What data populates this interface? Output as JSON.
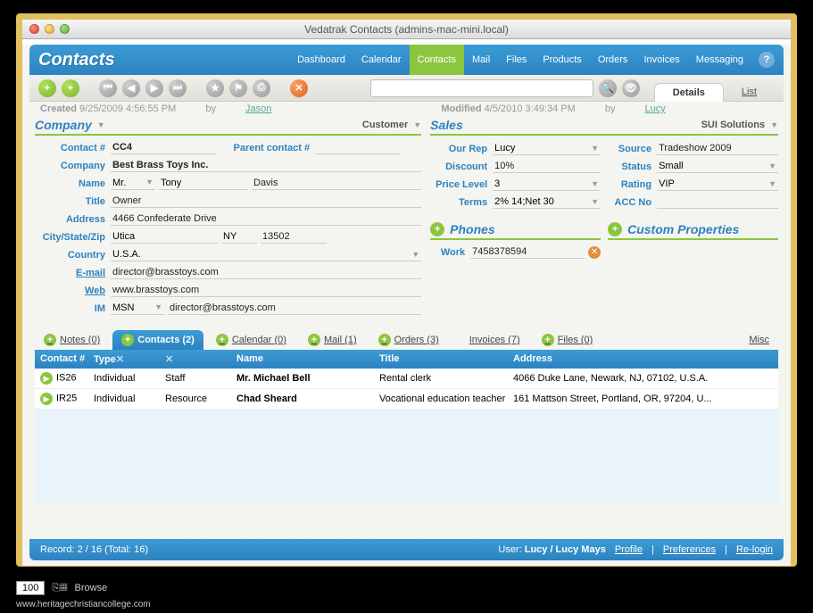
{
  "window_title": "Vedatrak Contacts (admins-mac-mini.local)",
  "brand": "Contacts",
  "nav": [
    "Dashboard",
    "Calendar",
    "Contacts",
    "Mail",
    "Files",
    "Products",
    "Orders",
    "Invoices",
    "Messaging"
  ],
  "nav_active": "Contacts",
  "right_tabs": {
    "details": "Details",
    "list": "List"
  },
  "meta": {
    "created_label": "Created",
    "created": "9/25/2009 4:56:55 PM",
    "created_by_label": "by",
    "created_by": "Jason",
    "modified_label": "Modified",
    "modified": "4/5/2010 3:49:34 PM",
    "modified_by_label": "by",
    "modified_by": "Lucy"
  },
  "company": {
    "section": "Company",
    "type_label": "Customer",
    "contact_no_label": "Contact #",
    "contact_no": "CC4",
    "parent_label": "Parent contact #",
    "parent": "",
    "company_label": "Company",
    "company": "Best Brass Toys Inc.",
    "name_label": "Name",
    "prefix": "Mr.",
    "first": "Tony",
    "last": "Davis",
    "title_label": "Title",
    "title": "Owner",
    "address_label": "Address",
    "address": "4466 Confederate Drive",
    "csz_label": "City/State/Zip",
    "city": "Utica",
    "state": "NY",
    "zip": "13502",
    "country_label": "Country",
    "country": "U.S.A.",
    "email_label": "E-mail",
    "email": "director@brasstoys.com",
    "web_label": "Web",
    "web": "www.brasstoys.com",
    "im_label": "IM",
    "im_type": "MSN",
    "im": "director@brasstoys.com"
  },
  "sales": {
    "section": "Sales",
    "company": "SUI Solutions",
    "rep_label": "Our Rep",
    "rep": "Lucy",
    "discount_label": "Discount",
    "discount": "10%",
    "price_label": "Price Level",
    "price": "3",
    "terms_label": "Terms",
    "terms": "2% 14;Net 30",
    "source_label": "Source",
    "source": "Tradeshow 2009",
    "status_label": "Status",
    "status": "Small",
    "rating_label": "Rating",
    "rating": "VIP",
    "acc_label": "ACC No",
    "acc": ""
  },
  "phones": {
    "section": "Phones",
    "work_label": "Work",
    "work": "7458378594"
  },
  "custom": {
    "section": "Custom Properties"
  },
  "subtabs": {
    "notes": "Notes (0)",
    "contacts": "Contacts (2)",
    "calendar": "Calendar (0)",
    "mail": "Mail (1)",
    "orders": "Orders (3)",
    "invoices": "Invoices (7)",
    "files": "Files (0)",
    "misc": "Misc"
  },
  "grid": {
    "headers": {
      "contact": "Contact #",
      "type": "Type",
      "name": "Name",
      "title": "Title",
      "address": "Address"
    },
    "rows": [
      {
        "id": "IS26",
        "type": "Individual",
        "role": "Staff",
        "name": "Mr. Michael Bell",
        "title": "Rental clerk",
        "address": "4066 Duke Lane, Newark, NJ, 07102, U.S.A."
      },
      {
        "id": "IR25",
        "type": "Individual",
        "role": "Resource",
        "name": "Chad Sheard",
        "title": "Vocational education teacher",
        "address": "161 Mattson Street, Portland, OR, 97204, U..."
      }
    ]
  },
  "status": {
    "record": "Record: 2 / 16 (Total: 16)",
    "user_label": "User:",
    "user": "Lucy / Lucy Mays",
    "profile": "Profile",
    "prefs": "Preferences",
    "relogin": "Re-login"
  },
  "footer": {
    "zoom": "100",
    "mode": "Browse",
    "url": "www.heritagechristiancollege.com"
  }
}
